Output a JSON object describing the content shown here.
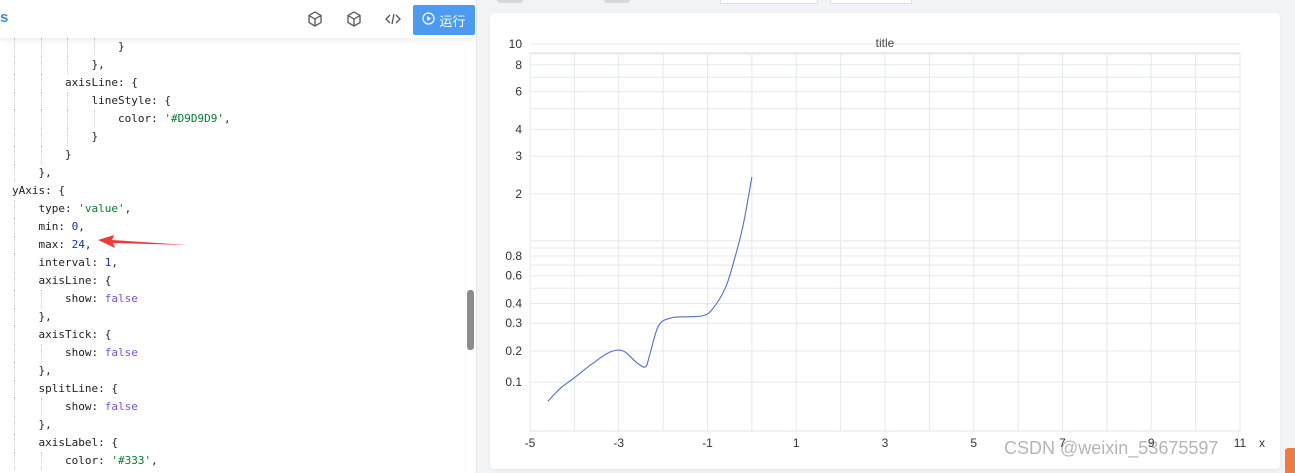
{
  "toolbar": {
    "brand_fragment": "s",
    "icons": [
      "cube-outline-icon",
      "cube-icon",
      "code-icon"
    ],
    "run_label": "运行",
    "run_color": "#4d9bf0"
  },
  "code_lines": [
    {
      "tokens": [
        {
          "t": "}",
          "c": "k"
        }
      ]
    },
    {
      "tokens": [
        {
          "t": "},",
          "c": "k"
        }
      ]
    },
    {
      "tokens": [
        {
          "t": "axisLine: {",
          "c": "k"
        }
      ]
    },
    {
      "tokens": [
        {
          "t": "lineStyle: {",
          "c": "k"
        }
      ]
    },
    {
      "tokens": [
        {
          "t": "color: ",
          "c": "k"
        },
        {
          "t": "'#D9D9D9'",
          "c": "s"
        },
        {
          "t": ",",
          "c": "k"
        }
      ]
    },
    {
      "tokens": [
        {
          "t": "}",
          "c": "k"
        }
      ]
    },
    {
      "tokens": [
        {
          "t": "}",
          "c": "k"
        }
      ]
    },
    {
      "tokens": [
        {
          "t": "},",
          "c": "k"
        }
      ]
    },
    {
      "tokens": [
        {
          "t": "yAxis: {",
          "c": "k"
        }
      ]
    },
    {
      "tokens": [
        {
          "t": "type: ",
          "c": "k"
        },
        {
          "t": "'value'",
          "c": "s"
        },
        {
          "t": ",",
          "c": "k"
        }
      ]
    },
    {
      "tokens": [
        {
          "t": "min: ",
          "c": "k"
        },
        {
          "t": "0",
          "c": "n"
        },
        {
          "t": ",",
          "c": "k"
        }
      ]
    },
    {
      "tokens": [
        {
          "t": "max: ",
          "c": "k"
        },
        {
          "t": "24",
          "c": "n"
        },
        {
          "t": ",",
          "c": "k"
        }
      ]
    },
    {
      "tokens": [
        {
          "t": "interval: ",
          "c": "k"
        },
        {
          "t": "1",
          "c": "n"
        },
        {
          "t": ",",
          "c": "k"
        }
      ]
    },
    {
      "tokens": [
        {
          "t": "axisLine: {",
          "c": "k"
        }
      ]
    },
    {
      "tokens": [
        {
          "t": "show: ",
          "c": "k"
        },
        {
          "t": "false",
          "c": "b"
        }
      ]
    },
    {
      "tokens": [
        {
          "t": "},",
          "c": "k"
        }
      ]
    },
    {
      "tokens": [
        {
          "t": "axisTick: {",
          "c": "k"
        }
      ]
    },
    {
      "tokens": [
        {
          "t": "show: ",
          "c": "k"
        },
        {
          "t": "false",
          "c": "b"
        }
      ]
    },
    {
      "tokens": [
        {
          "t": "},",
          "c": "k"
        }
      ]
    },
    {
      "tokens": [
        {
          "t": "splitLine: {",
          "c": "k"
        }
      ]
    },
    {
      "tokens": [
        {
          "t": "show: ",
          "c": "k"
        },
        {
          "t": "false",
          "c": "b"
        }
      ]
    },
    {
      "tokens": [
        {
          "t": "},",
          "c": "k"
        }
      ]
    },
    {
      "tokens": [
        {
          "t": "axisLabel: {",
          "c": "k"
        }
      ]
    },
    {
      "tokens": [
        {
          "t": "color: ",
          "c": "k"
        },
        {
          "t": "'#333'",
          "c": "s"
        },
        {
          "t": ",",
          "c": "k"
        }
      ]
    }
  ],
  "chart_data": {
    "type": "line",
    "title": "title",
    "xlabel": "x",
    "ylabel": "",
    "xlim": [
      -5,
      11
    ],
    "x_ticks": [
      -5,
      -3,
      -1,
      1,
      3,
      5,
      7,
      9,
      11
    ],
    "y_scale": "log",
    "y_ticks": [
      0.1,
      0.2,
      0.3,
      0.4,
      0.6,
      0.8,
      2,
      3,
      4,
      6,
      8,
      10
    ],
    "grid": true,
    "series": [
      {
        "color": "#5470c6",
        "x": [
          -4.6,
          -4.3,
          -4.0,
          -3.6,
          -3.2,
          -2.9,
          -2.6,
          -2.4,
          -2.3,
          -2.1,
          -1.8,
          -1.4,
          -1.1,
          -0.9,
          -0.6,
          -0.4,
          -0.2,
          0.0
        ],
        "y": [
          0.065,
          0.088,
          0.11,
          0.15,
          0.195,
          0.2,
          0.155,
          0.14,
          0.185,
          0.29,
          0.325,
          0.33,
          0.335,
          0.365,
          0.5,
          0.75,
          1.25,
          2.4
        ]
      }
    ]
  },
  "watermark": "CSDN @weixin_53675597"
}
